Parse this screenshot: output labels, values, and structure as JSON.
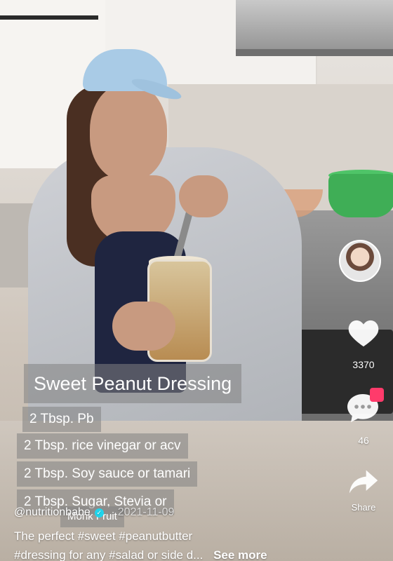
{
  "overlay": {
    "title": "Sweet Peanut Dressing",
    "ingredients": [
      "2 Tbsp. Pb",
      "2 Tbsp. rice vinegar or acv",
      "2 Tbsp. Soy sauce or tamari",
      "2 Tbsp. Sugar, Stevia or",
      "Monk Fruit"
    ]
  },
  "rail": {
    "likes": "3370",
    "comments": "46",
    "share_label": "Share"
  },
  "post": {
    "handle": "@nutritionbabe",
    "date": "2021-11-09",
    "description_line1": "The perfect #sweet #peanutbutter",
    "description_line2": "#dressing for any #salad or side d...",
    "see_more": "See more"
  },
  "colors": {
    "like_icon": "#ffffff",
    "verified": "#20d5ec",
    "gift_badge": "#ff3b6b"
  }
}
